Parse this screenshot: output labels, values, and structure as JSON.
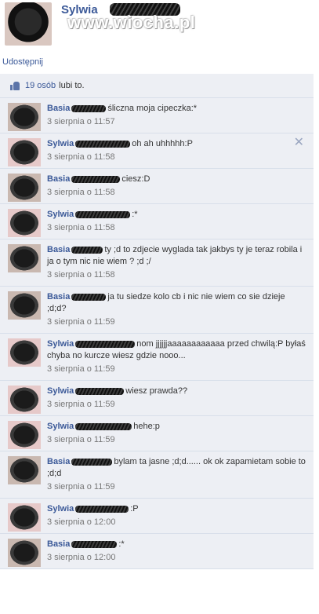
{
  "header": {
    "name": "Sylwia",
    "watermark": "www.wiocha.pl"
  },
  "share_link": "Udostępnij",
  "likes": {
    "count_label": "19 osób",
    "suffix": "lubi to."
  },
  "comments": [
    {
      "author": "Basia",
      "text": "śliczna moja cipeczka:*",
      "time": "3 sierpnia o 11:57"
    },
    {
      "author": "Sylwia",
      "text": "oh ah uhhhhh:P",
      "time": "3 sierpnia o 11:58"
    },
    {
      "author": "Basia",
      "text": "ciesz:D",
      "time": "3 sierpnia o 11:58"
    },
    {
      "author": "Sylwia",
      "text": ":*",
      "time": "3 sierpnia o 11:58"
    },
    {
      "author": "Basia",
      "text": "ty ;d to zdjecie wyglada tak jakbys ty je teraz robila i ja o tym nic nie wiem ? ;d ;/",
      "time": "3 sierpnia o 11:58"
    },
    {
      "author": "Basia",
      "text": "ja tu siedze kolo cb i nic nie wiem co sie dzieje ;d;d?",
      "time": "3 sierpnia o 11:59"
    },
    {
      "author": "Sylwia",
      "text": "nom jjjjjjaaaaaaaaaaaa przed chwilą:P byłaś chyba no kurcze wiesz gdzie nooo...",
      "time": "3 sierpnia o 11:59"
    },
    {
      "author": "Sylwia",
      "text": "wiesz prawda??",
      "time": "3 sierpnia o 11:59"
    },
    {
      "author": "Sylwia",
      "text": "hehe:p",
      "time": "3 sierpnia o 11:59"
    },
    {
      "author": "Basia",
      "text": "bylam ta jasne ;d;d...... ok ok zapamietam sobie to ;d;d",
      "time": "3 sierpnia o 11:59"
    },
    {
      "author": "Sylwia",
      "text": ":P",
      "time": "3 sierpnia o 12:00"
    },
    {
      "author": "Basia",
      "text": ":*",
      "time": "3 sierpnia o 12:00"
    }
  ],
  "close_icon": "close-icon",
  "colors": {
    "link": "#3b5998",
    "comment_bg": "#edeff4",
    "border": "#d8dfea"
  }
}
